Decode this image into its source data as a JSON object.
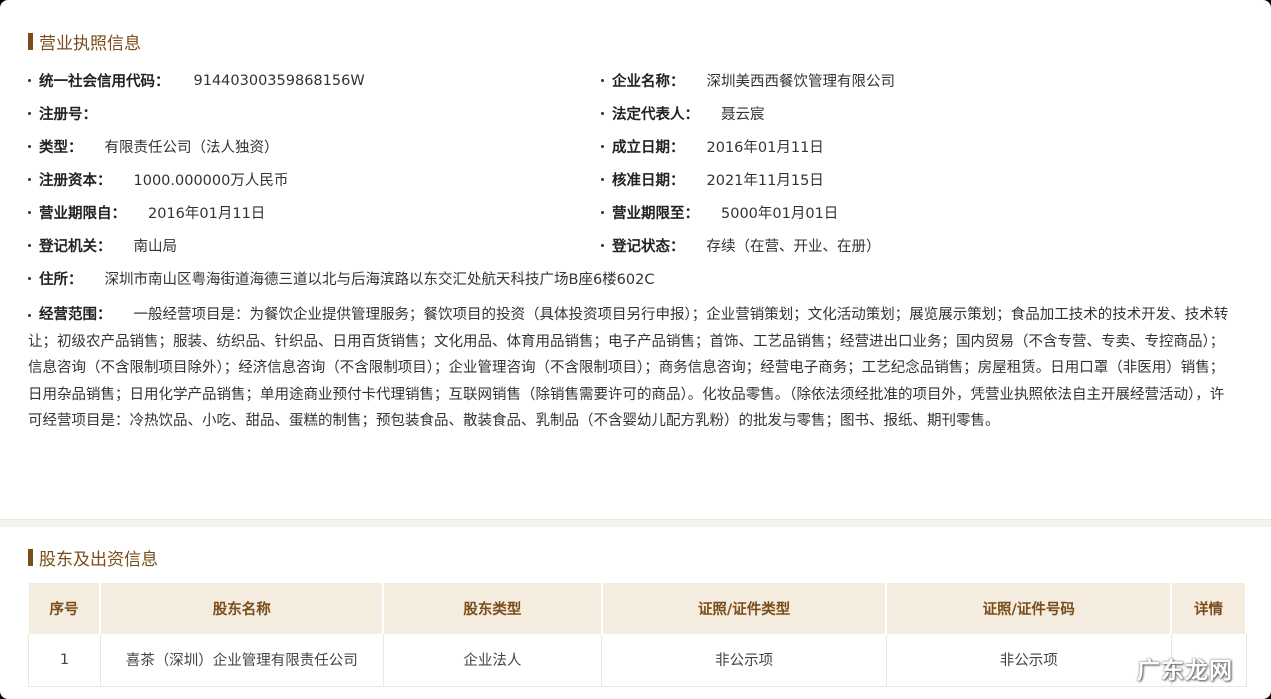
{
  "license_section": {
    "title": "营业执照信息",
    "left_fields": [
      {
        "label": "统一社会信用代码：",
        "value": "91440300359868156W"
      },
      {
        "label": "注册号：",
        "value": ""
      },
      {
        "label": "类型：",
        "value": "有限责任公司（法人独资）"
      },
      {
        "label": "注册资本：",
        "value": "1000.000000万人民币"
      },
      {
        "label": "营业期限自：",
        "value": "2016年01月11日"
      },
      {
        "label": "登记机关：",
        "value": "南山局"
      }
    ],
    "right_fields": [
      {
        "label": "企业名称：",
        "value": "深圳美西西餐饮管理有限公司"
      },
      {
        "label": "法定代表人：",
        "value": "聂云宸"
      },
      {
        "label": "成立日期：",
        "value": "2016年01月11日"
      },
      {
        "label": "核准日期：",
        "value": "2021年11月15日"
      },
      {
        "label": "营业期限至：",
        "value": "5000年01月01日"
      },
      {
        "label": "登记状态：",
        "value": "存续（在营、开业、在册）"
      }
    ],
    "address": {
      "label": "住所：",
      "value": "深圳市南山区粤海街道海德三道以北与后海滨路以东交汇处航天科技广场B座6楼602C"
    },
    "scope": {
      "label": "经营范围：",
      "value": "一般经营项目是：为餐饮企业提供管理服务；餐饮项目的投资（具体投资项目另行申报）；企业营销策划；文化活动策划；展览展示策划；食品加工技术的技术开发、技术转让；初级农产品销售；服装、纺织品、针织品、日用百货销售；文化用品、体育用品销售；电子产品销售；首饰、工艺品销售；经营进出口业务；国内贸易（不含专营、专卖、专控商品）；信息咨询（不含限制项目除外）；经济信息咨询（不含限制项目）；企业管理咨询（不含限制项目）；商务信息咨询；经营电子商务；工艺纪念品销售；房屋租赁。日用口罩（非医用）销售；日用杂品销售；日用化学产品销售；单用途商业预付卡代理销售；互联网销售（除销售需要许可的商品）。化妆品零售。（除依法须经批准的项目外，凭营业执照依法自主开展经营活动），许可经营项目是：冷热饮品、小吃、甜品、蛋糕的制售；预包装食品、散装食品、乳制品（不含婴幼儿配方乳粉）的批发与零售；图书、报纸、期刊零售。"
    }
  },
  "shareholder_section": {
    "title": "股东及出资信息",
    "columns": [
      "序号",
      "股东名称",
      "股东类型",
      "证照/证件类型",
      "证照/证件号码",
      "详情"
    ],
    "rows": [
      [
        "1",
        "喜茶（深圳）企业管理有限责任公司",
        "企业法人",
        "非公示项",
        "非公示项",
        ""
      ]
    ]
  },
  "watermark": "广东龙网"
}
